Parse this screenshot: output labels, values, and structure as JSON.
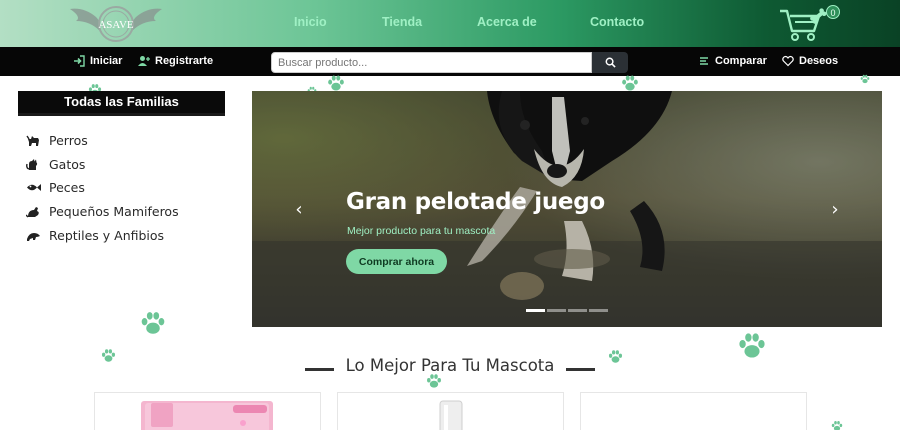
{
  "brand": {
    "logo_text": "ASAVE"
  },
  "nav": {
    "links": [
      {
        "label": "Inicio"
      },
      {
        "label": "Tienda"
      },
      {
        "label": "Acerca de"
      },
      {
        "label": "Contacto"
      }
    ],
    "cart_count": "0"
  },
  "account_bar": {
    "login_label": "Iniciar",
    "register_label": "Registrarte",
    "search_placeholder": "Buscar producto...",
    "compare_label": "Comparar",
    "wishlist_label": "Deseos"
  },
  "sidebar": {
    "title": "Todas las Familias",
    "items": [
      {
        "label": "Perros",
        "icon": "dog-icon"
      },
      {
        "label": "Gatos",
        "icon": "cat-icon"
      },
      {
        "label": "Peces",
        "icon": "fish-icon"
      },
      {
        "label": "Pequeños Mamiferos",
        "icon": "small-mammal-icon"
      },
      {
        "label": "Reptiles y Anfibios",
        "icon": "reptile-icon"
      }
    ]
  },
  "carousel": {
    "title": "Gran pelotade juego",
    "subtitle": "Mejor producto para tu mascota",
    "button_label": "Comprar ahora",
    "prev_arrow": "‹",
    "next_arrow": "›",
    "slide_count": 4,
    "active_slide": 1
  },
  "section": {
    "heading": "Lo Mejor Para Tu Mascota"
  },
  "colors": {
    "accent": "#7fd8a5",
    "nav_text": "#9ff0c4",
    "header_dark": "#0a4225",
    "paw": "#6cc596"
  }
}
